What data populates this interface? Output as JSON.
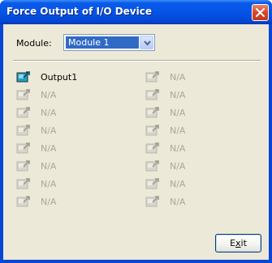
{
  "window": {
    "title": "Force Output of I/O Device"
  },
  "module": {
    "label": "Module:",
    "selected": "Module 1"
  },
  "outputs": {
    "left": [
      {
        "label": "Output1",
        "enabled": true
      },
      {
        "label": "N/A",
        "enabled": false
      },
      {
        "label": "N/A",
        "enabled": false
      },
      {
        "label": "N/A",
        "enabled": false
      },
      {
        "label": "N/A",
        "enabled": false
      },
      {
        "label": "N/A",
        "enabled": false
      },
      {
        "label": "N/A",
        "enabled": false
      },
      {
        "label": "N/A",
        "enabled": false
      }
    ],
    "right": [
      {
        "label": "N/A",
        "enabled": false
      },
      {
        "label": "N/A",
        "enabled": false
      },
      {
        "label": "N/A",
        "enabled": false
      },
      {
        "label": "N/A",
        "enabled": false
      },
      {
        "label": "N/A",
        "enabled": false
      },
      {
        "label": "N/A",
        "enabled": false
      },
      {
        "label": "N/A",
        "enabled": false
      },
      {
        "label": "N/A",
        "enabled": false
      }
    ]
  },
  "footer": {
    "exit_prefix": "E",
    "exit_mnemonic": "x",
    "exit_suffix": "it"
  },
  "colors": {
    "titlebar": "#0554e6",
    "selection": "#316ac5",
    "dialog_bg": "#ece9d8",
    "disabled_text": "#aca899"
  },
  "icons": {
    "close": "close-icon",
    "dropdown": "chevron-down-icon",
    "output": "force-output-icon"
  }
}
